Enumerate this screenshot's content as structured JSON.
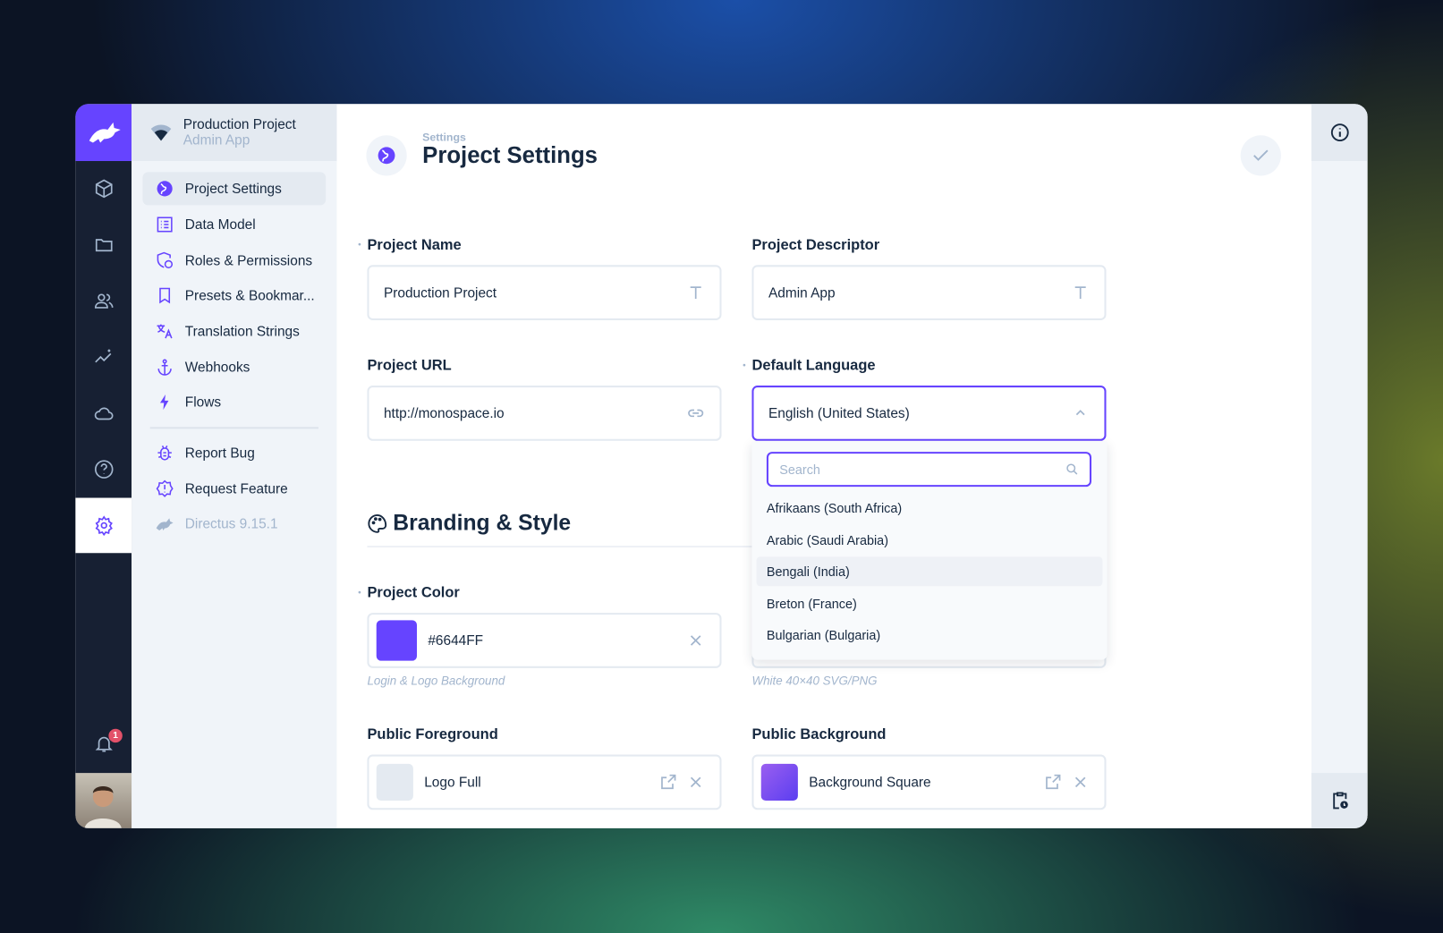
{
  "colors": {
    "accent": "#6644FF",
    "rail": "#172033",
    "badge": "#E35169"
  },
  "project": {
    "name": "Production Project",
    "descriptor": "Admin App"
  },
  "rail": {
    "icons": [
      "box-icon",
      "folder-icon",
      "users-icon",
      "insights-icon",
      "cloud-icon",
      "help-icon",
      "settings-icon"
    ],
    "notifications": "1"
  },
  "nav": {
    "items": [
      {
        "label": "Project Settings",
        "icon": "globe-icon",
        "active": true
      },
      {
        "label": "Data Model",
        "icon": "list-icon"
      },
      {
        "label": "Roles & Permissions",
        "icon": "shield-user-icon"
      },
      {
        "label": "Presets & Bookmar...",
        "icon": "bookmark-icon"
      },
      {
        "label": "Translation Strings",
        "icon": "translate-icon"
      },
      {
        "label": "Webhooks",
        "icon": "anchor-icon"
      },
      {
        "label": "Flows",
        "icon": "bolt-icon"
      }
    ],
    "secondary": [
      {
        "label": "Report Bug",
        "icon": "bug-icon"
      },
      {
        "label": "Request Feature",
        "icon": "feature-icon"
      }
    ],
    "version": "Directus 9.15.1"
  },
  "header": {
    "breadcrumb": "Settings",
    "title": "Project Settings"
  },
  "form": {
    "project_name": {
      "label": "Project Name",
      "value": "Production Project"
    },
    "project_descriptor": {
      "label": "Project Descriptor",
      "value": "Admin App"
    },
    "project_url": {
      "label": "Project URL",
      "value": "http://monospace.io"
    },
    "default_language": {
      "label": "Default Language",
      "value": "English (United States)"
    },
    "branding_heading": "Branding & Style",
    "project_color": {
      "label": "Project Color",
      "value": "#6644FF",
      "hint": "Login & Logo Background"
    },
    "project_logo": {
      "hint": "White 40×40 SVG/PNG"
    },
    "public_foreground": {
      "label": "Public Foreground",
      "value": "Logo Full"
    },
    "public_background": {
      "label": "Public Background",
      "value": "Background Square"
    }
  },
  "dropdown": {
    "search_placeholder": "Search",
    "options": [
      "Afrikaans (South Africa)",
      "Arabic (Saudi Arabia)",
      "Bengali (India)",
      "Breton (France)",
      "Bulgarian (Bulgaria)"
    ],
    "highlighted": "Bengali (India)"
  }
}
